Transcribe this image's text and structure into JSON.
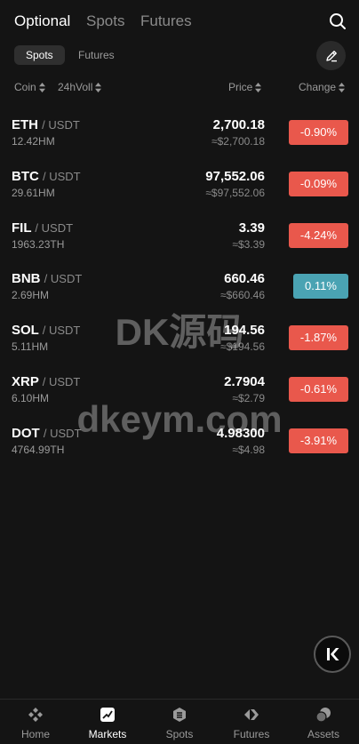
{
  "top_tabs": [
    {
      "label": "Optional",
      "active": true
    },
    {
      "label": "Spots",
      "active": false
    },
    {
      "label": "Futures",
      "active": false
    }
  ],
  "sub_tabs": [
    {
      "label": "Spots",
      "active": true
    },
    {
      "label": "Futures",
      "active": false
    }
  ],
  "columns": {
    "coin": "Coin",
    "volume": "24hVoll",
    "price": "Price",
    "change": "Change"
  },
  "rows": [
    {
      "base": "ETH",
      "quote": "/ USDT",
      "volume": "12.42HM",
      "price": "2,700.18",
      "approx": "≈$2,700.18",
      "change": "-0.90%",
      "direction": "down"
    },
    {
      "base": "BTC",
      "quote": "/ USDT",
      "volume": "29.61HM",
      "price": "97,552.06",
      "approx": "≈$97,552.06",
      "change": "-0.09%",
      "direction": "down"
    },
    {
      "base": "FIL",
      "quote": "/ USDT",
      "volume": "1963.23TH",
      "price": "3.39",
      "approx": "≈$3.39",
      "change": "-4.24%",
      "direction": "down"
    },
    {
      "base": "BNB",
      "quote": "/ USDT",
      "volume": "2.69HM",
      "price": "660.46",
      "approx": "≈$660.46",
      "change": "0.11%",
      "direction": "up"
    },
    {
      "base": "SOL",
      "quote": "/ USDT",
      "volume": "5.11HM",
      "price": "194.56",
      "approx": "≈$194.56",
      "change": "-1.87%",
      "direction": "down"
    },
    {
      "base": "XRP",
      "quote": "/ USDT",
      "volume": "6.10HM",
      "price": "2.7904",
      "approx": "≈$2.79",
      "change": "-0.61%",
      "direction": "down"
    },
    {
      "base": "DOT",
      "quote": "/ USDT",
      "volume": "4764.99TH",
      "price": "4.98300",
      "approx": "≈$4.98",
      "change": "-3.91%",
      "direction": "down"
    }
  ],
  "watermark": {
    "line1": "DK源码",
    "line2": "dkeym.com"
  },
  "bottom_nav": [
    {
      "label": "Home",
      "icon": "home-icon",
      "active": false
    },
    {
      "label": "Markets",
      "icon": "markets-icon",
      "active": true
    },
    {
      "label": "Spots",
      "icon": "spots-icon",
      "active": false
    },
    {
      "label": "Futures",
      "icon": "futures-icon",
      "active": false
    },
    {
      "label": "Assets",
      "icon": "assets-icon",
      "active": false
    }
  ],
  "colors": {
    "background": "#141414",
    "down": "#e9584c",
    "up": "#4aa3b3",
    "muted": "#9a9a9a"
  }
}
